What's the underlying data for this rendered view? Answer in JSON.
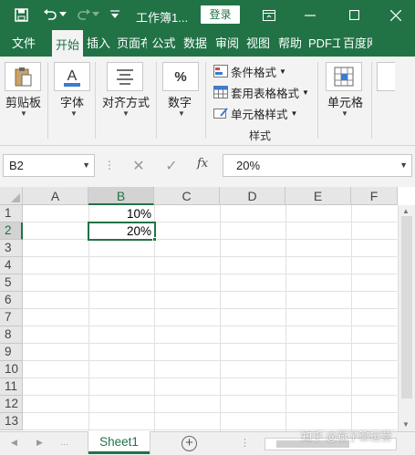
{
  "titlebar": {
    "title": "工作簿1...",
    "login_label": "登录"
  },
  "tabs": [
    {
      "label": "文件"
    },
    {
      "label": "开始"
    },
    {
      "label": "插入"
    },
    {
      "label": "页面布"
    },
    {
      "label": "公式"
    },
    {
      "label": "数据"
    },
    {
      "label": "审阅"
    },
    {
      "label": "视图"
    },
    {
      "label": "帮助"
    },
    {
      "label": "PDF工"
    },
    {
      "label": "百度网"
    }
  ],
  "ribbon": {
    "clipboard_label": "剪贴板",
    "font_label": "字体",
    "alignment_label": "对齐方式",
    "number_label": "数字",
    "cond_format_label": "条件格式",
    "table_format_label": "套用表格格式",
    "cell_style_label": "单元格样式",
    "styles_group_label": "样式",
    "cells_label": "单元格",
    "number_icon_text": "%",
    "font_icon_text": "A"
  },
  "formula_bar": {
    "name_box": "B2",
    "fx_label": "fx",
    "formula": "20%"
  },
  "grid": {
    "columns": [
      "A",
      "B",
      "C",
      "D",
      "E",
      "F"
    ],
    "rows": [
      "1",
      "2",
      "3",
      "4",
      "5",
      "6",
      "7",
      "8",
      "9",
      "10",
      "11",
      "12",
      "13"
    ],
    "cells": {
      "B1": "10%",
      "B2": "20%"
    },
    "selected_cell": "B2"
  },
  "sheets": [
    {
      "name": "Sheet1"
    }
  ],
  "watermark": "知乎 @燕子聊运营",
  "colors": {
    "accent": "#217346"
  }
}
